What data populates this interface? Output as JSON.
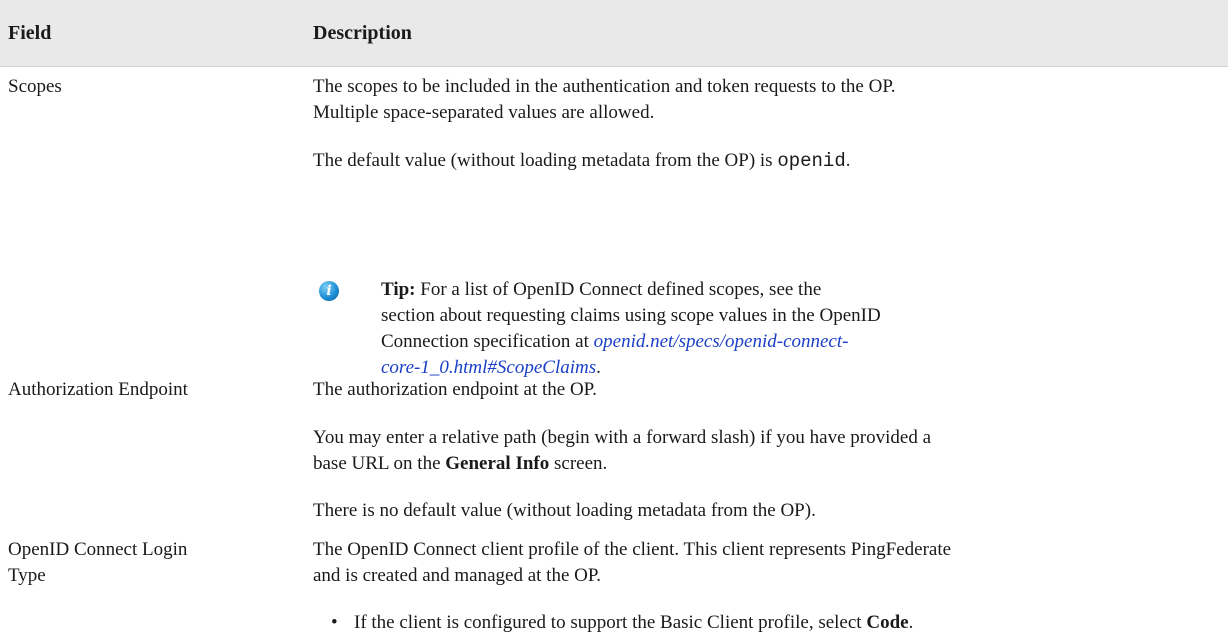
{
  "header": {
    "field": "Field",
    "description": "Description"
  },
  "rows": {
    "scopes": {
      "field": "Scopes",
      "p1_l1": "The scopes to be included in the authentication and token requests to the OP.",
      "p1_l2": "Multiple space-separated values are allowed.",
      "p2_pre": "The default value (without loading metadata from the OP) is ",
      "p2_code": "openid",
      "p2_post": ".",
      "tip_label": "Tip:",
      "tip_l1": " For a list of OpenID Connect defined scopes, see the",
      "tip_l2": "section about requesting claims using scope values in the OpenID",
      "tip_l3_pre": "Connection specification at ",
      "tip_link_1": "openid.net/specs/openid-connect-",
      "tip_link_2": "core-1_0.html#ScopeClaims",
      "tip_end": ".",
      "icon": "info-icon"
    },
    "auth": {
      "field": "Authorization Endpoint",
      "p1": "The authorization endpoint at the OP.",
      "p2_l1": "You may enter a relative path (begin with a forward slash) if you have provided a",
      "p2_l2_pre": "base URL on the ",
      "p2_bold": "General Info",
      "p2_l2_post": " screen.",
      "p3": "There is no default value (without loading metadata from the OP)."
    },
    "login": {
      "field_l1": "OpenID Connect Login",
      "field_l2": "Type",
      "p1_l1": "The OpenID Connect client profile of the client. This client represents PingFederate",
      "p1_l2": "and is created and managed at the OP.",
      "bullet": "•",
      "b1_pre": "If the client is configured to support the Basic Client profile, select ",
      "b1_bold": "Code",
      "b1_post": "."
    }
  }
}
